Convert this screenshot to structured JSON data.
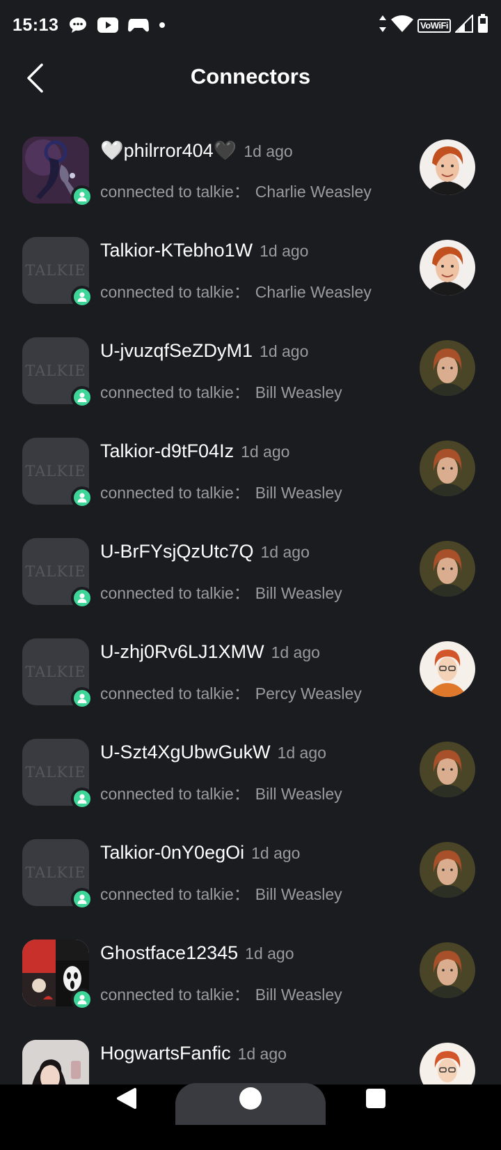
{
  "status_bar": {
    "time": "15:13",
    "left_icons": [
      "chat-bubble-icon",
      "youtube-icon",
      "game-controller-icon",
      "dot-icon"
    ],
    "right_icons": [
      "data-arrows-icon",
      "wifi-icon",
      "vowifi-icon",
      "signal-icon",
      "battery-icon"
    ],
    "vowifi_label": "VoWiFi"
  },
  "header": {
    "title": "Connectors",
    "back_icon": "chevron-left-icon"
  },
  "list": {
    "sub_prefix": "connected to talkie",
    "sub_separator": "：",
    "placeholder_logo_text": "TALKIE",
    "items": [
      {
        "name": "🤍philrror404🖤",
        "time": "1d ago",
        "character": "Charlie Weasley",
        "thumb": "custom-purple"
      },
      {
        "name": "Talkior-KTebho1W",
        "time": "1d ago",
        "character": "Charlie Weasley",
        "thumb": "talkie-logo"
      },
      {
        "name": "U-jvuzqfSeZDyM1",
        "time": "1d ago",
        "character": "Bill Weasley",
        "thumb": "talkie-logo"
      },
      {
        "name": "Talkior-d9tF04Iz",
        "time": "1d ago",
        "character": "Bill Weasley",
        "thumb": "talkie-logo"
      },
      {
        "name": "U-BrFYsjQzUtc7Q",
        "time": "1d ago",
        "character": "Bill Weasley",
        "thumb": "talkie-logo"
      },
      {
        "name": "U-zhj0Rv6LJ1XMW",
        "time": "1d ago",
        "character": "Percy Weasley",
        "thumb": "talkie-logo"
      },
      {
        "name": "U-Szt4XgUbwGukW",
        "time": "1d ago",
        "character": "Bill Weasley",
        "thumb": "talkie-logo"
      },
      {
        "name": "Talkior-0nY0egOi",
        "time": "1d ago",
        "character": "Bill Weasley",
        "thumb": "talkie-logo"
      },
      {
        "name": "Ghostface12345",
        "time": "1d ago",
        "character": "Bill Weasley",
        "thumb": "custom-ghostface"
      },
      {
        "name": "HogwartsFanfic",
        "time": "1d ago",
        "character": "",
        "thumb": "custom-photo"
      }
    ]
  },
  "colors": {
    "background": "#1b1c20",
    "badge_green": "#3ed598",
    "secondary_text": "#9a9ba0",
    "placeholder_bg": "#3a3b40"
  },
  "nav_bar": {
    "icons": [
      "back-triangle-icon",
      "home-circle-icon",
      "recents-square-icon"
    ]
  }
}
